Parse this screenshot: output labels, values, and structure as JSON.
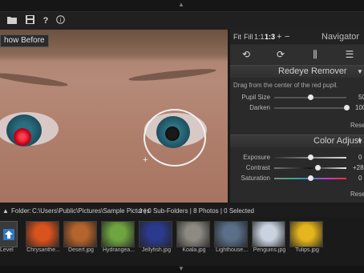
{
  "toolbar": {
    "icons": [
      "folder-icon",
      "save-icon",
      "help-icon",
      "info-icon"
    ],
    "show_before_label": "how Before",
    "help_glyph": "?",
    "info_glyph": "i"
  },
  "navigator": {
    "zoom_fit": "Fit",
    "zoom_fill": "Fill",
    "zoom_1_1": "1:1",
    "zoom_1_3": "1:3",
    "zoom_in": "+",
    "zoom_out": "−",
    "title": "Navigator"
  },
  "redeye": {
    "title": "Redeye Remover",
    "hint": "Drag from the center of the red pupil.",
    "pupil_size_label": "Pupil Size",
    "pupil_size_value": "50",
    "pupil_size_level": 0.5,
    "darken_label": "Darken",
    "darken_value": "100",
    "darken_level": 1.0,
    "reset_label": "Reset"
  },
  "color_adjust": {
    "title": "Color Adjust",
    "exposure_label": "Exposure",
    "exposure_value": "0",
    "exposure_level": 0.5,
    "contrast_label": "Contrast",
    "contrast_value": "+28",
    "contrast_level": 0.6,
    "saturation_label": "Saturation",
    "saturation_value": "0",
    "saturation_level": 0.5,
    "reset_label": "Reset"
  },
  "folder": {
    "label": "Folder:",
    "path": "C:\\Users\\Public\\Pictures\\Sample Pictures",
    "summary": "| 0 Sub-Folders | 8 Photos | 0 Selected"
  },
  "filmstrip": {
    "up_label": "Level",
    "items": [
      {
        "caption": "Chrysanthe...",
        "color": "#d9531e"
      },
      {
        "caption": "Desert.jpg",
        "color": "#b5642d"
      },
      {
        "caption": "Hydrangea...",
        "color": "#6fa540"
      },
      {
        "caption": "Jellyfish.jpg",
        "color": "#2b3a8c"
      },
      {
        "caption": "Koala.jpg",
        "color": "#8d8a82"
      },
      {
        "caption": "Lighthouse...",
        "color": "#5a6f8a"
      },
      {
        "caption": "Penguins.jpg",
        "color": "#c9d3e0"
      },
      {
        "caption": "Tulips.jpg",
        "color": "#e4b51c"
      }
    ]
  }
}
